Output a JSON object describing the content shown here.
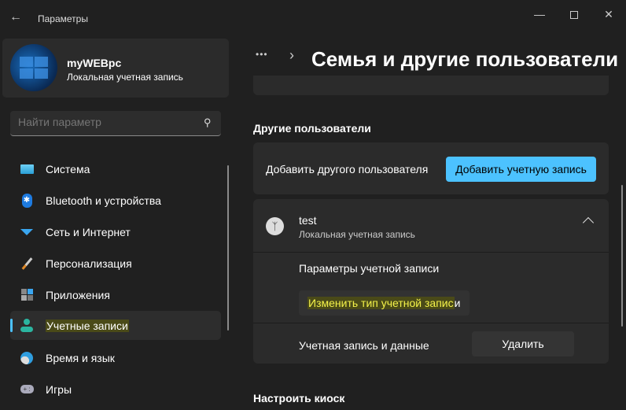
{
  "window": {
    "title": "Параметры",
    "back": "arrow-left-icon",
    "minimize": "minimize-icon",
    "maximize": "maximize-icon",
    "close": "close-icon"
  },
  "profile": {
    "name": "myWEBpc",
    "type": "Локальная учетная запись"
  },
  "search": {
    "placeholder": "Найти параметр"
  },
  "sidebar": {
    "items": [
      {
        "label": "Система",
        "icon": "monitor-icon"
      },
      {
        "label": "Bluetooth и устройства",
        "icon": "bluetooth-icon"
      },
      {
        "label": "Сеть и Интернет",
        "icon": "wifi-icon"
      },
      {
        "label": "Персонализация",
        "icon": "brush-icon"
      },
      {
        "label": "Приложения",
        "icon": "apps-icon"
      },
      {
        "label": "Учетные записи",
        "icon": "person-icon",
        "active": true
      },
      {
        "label": "Время и язык",
        "icon": "clock-globe-icon"
      },
      {
        "label": "Игры",
        "icon": "gamepad-icon"
      }
    ]
  },
  "header": {
    "ellipsis": "•••",
    "title": "Семья и другие пользователи"
  },
  "other_users": {
    "heading": "Другие пользователи",
    "add_label": "Добавить другого пользователя",
    "add_button": "Добавить учетную запись"
  },
  "user": {
    "name": "test",
    "type": "Локальная учетная запись",
    "options_label": "Параметры учетной записи",
    "change_type_highlight": "Изменить тип учетной запис",
    "change_type_tail": "и",
    "data_label": "Учетная запись и данные",
    "delete_button": "Удалить"
  },
  "kiosk": {
    "heading": "Настроить киоск"
  },
  "colors": {
    "accent": "#4cc2ff",
    "highlight_text": "#f4f24a",
    "background": "#202020",
    "card": "#2b2b2b"
  }
}
